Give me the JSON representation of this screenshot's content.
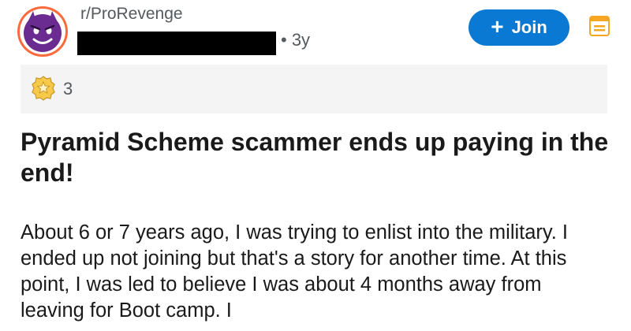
{
  "header": {
    "subreddit": "r/ProRevenge",
    "author": "",
    "age": "• 3y",
    "join_label": "Join",
    "join_plus": "+"
  },
  "awards": {
    "count": "3"
  },
  "post": {
    "title": "Pyramid Scheme scammer ends up paying in the end!",
    "body": "About 6 or 7 years ago, I was trying to enlist into the military.  I ended up not joining but that's a story for another time.  At this point, I was led to believe I was about 4 months away from leaving for Boot camp.  I"
  },
  "colors": {
    "join_button": "#0a79d3",
    "menu_icon": "#f5a623",
    "avatar_border": "#ff6a3d",
    "avatar_face": "#6a2c91",
    "award_bar": "#f4f4f4"
  },
  "icons": [
    "devil-face-icon",
    "award-icon",
    "menu-icon"
  ]
}
